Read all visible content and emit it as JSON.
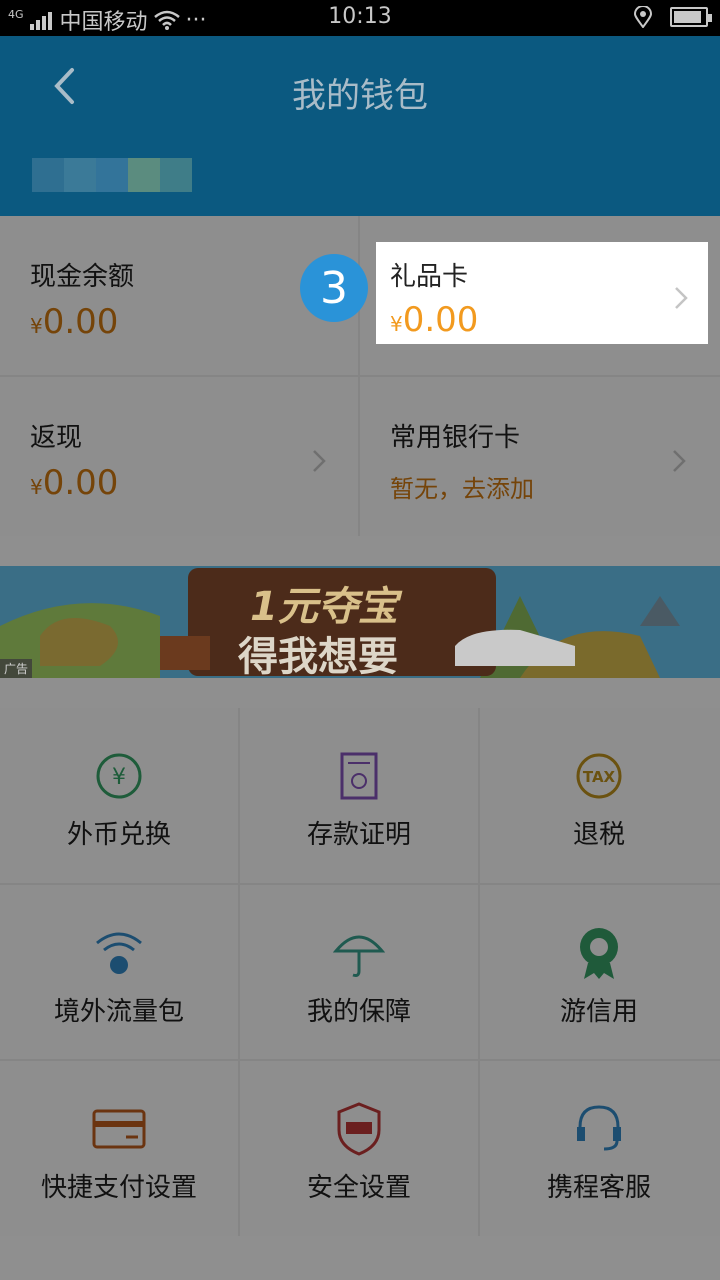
{
  "status_bar": {
    "network_type": "4G",
    "carrier": "中国移动",
    "more": "···",
    "time": "10:13",
    "battery_level": 0.9
  },
  "header": {
    "title": "我的钱包",
    "back_icon": "chevron-left-icon",
    "background_color": "#0b5980"
  },
  "balances": {
    "cash": {
      "label": "现金余额",
      "currency": "¥",
      "value": "0.00"
    },
    "gift_card": {
      "label": "礼品卡",
      "currency": "¥",
      "value": "0.00"
    },
    "cashback": {
      "label": "返现",
      "currency": "¥",
      "value": "0.00"
    },
    "bank_card": {
      "label": "常用银行卡",
      "status": "暂无，去添加"
    }
  },
  "tutorial_step": "3",
  "banner": {
    "ad_label": "广告",
    "line1": "1元夺宝",
    "line2": "得我想要"
  },
  "services": [
    {
      "label": "外币兑换",
      "icon": "currency-exchange-icon"
    },
    {
      "label": "存款证明",
      "icon": "deposit-certificate-icon"
    },
    {
      "label": "退税",
      "icon": "tax-icon"
    },
    {
      "label": "境外流量包",
      "icon": "wifi-globe-icon"
    },
    {
      "label": "我的保障",
      "icon": "umbrella-icon"
    },
    {
      "label": "游信用",
      "icon": "credit-badge-icon"
    },
    {
      "label": "快捷支付设置",
      "icon": "card-icon"
    },
    {
      "label": "安全设置",
      "icon": "shield-warning-icon"
    },
    {
      "label": "携程客服",
      "icon": "headset-icon"
    }
  ],
  "colors": {
    "accent_orange": "#f29a1f",
    "dimmed_orange": "#754409",
    "step_blue": "#2a93d8"
  }
}
